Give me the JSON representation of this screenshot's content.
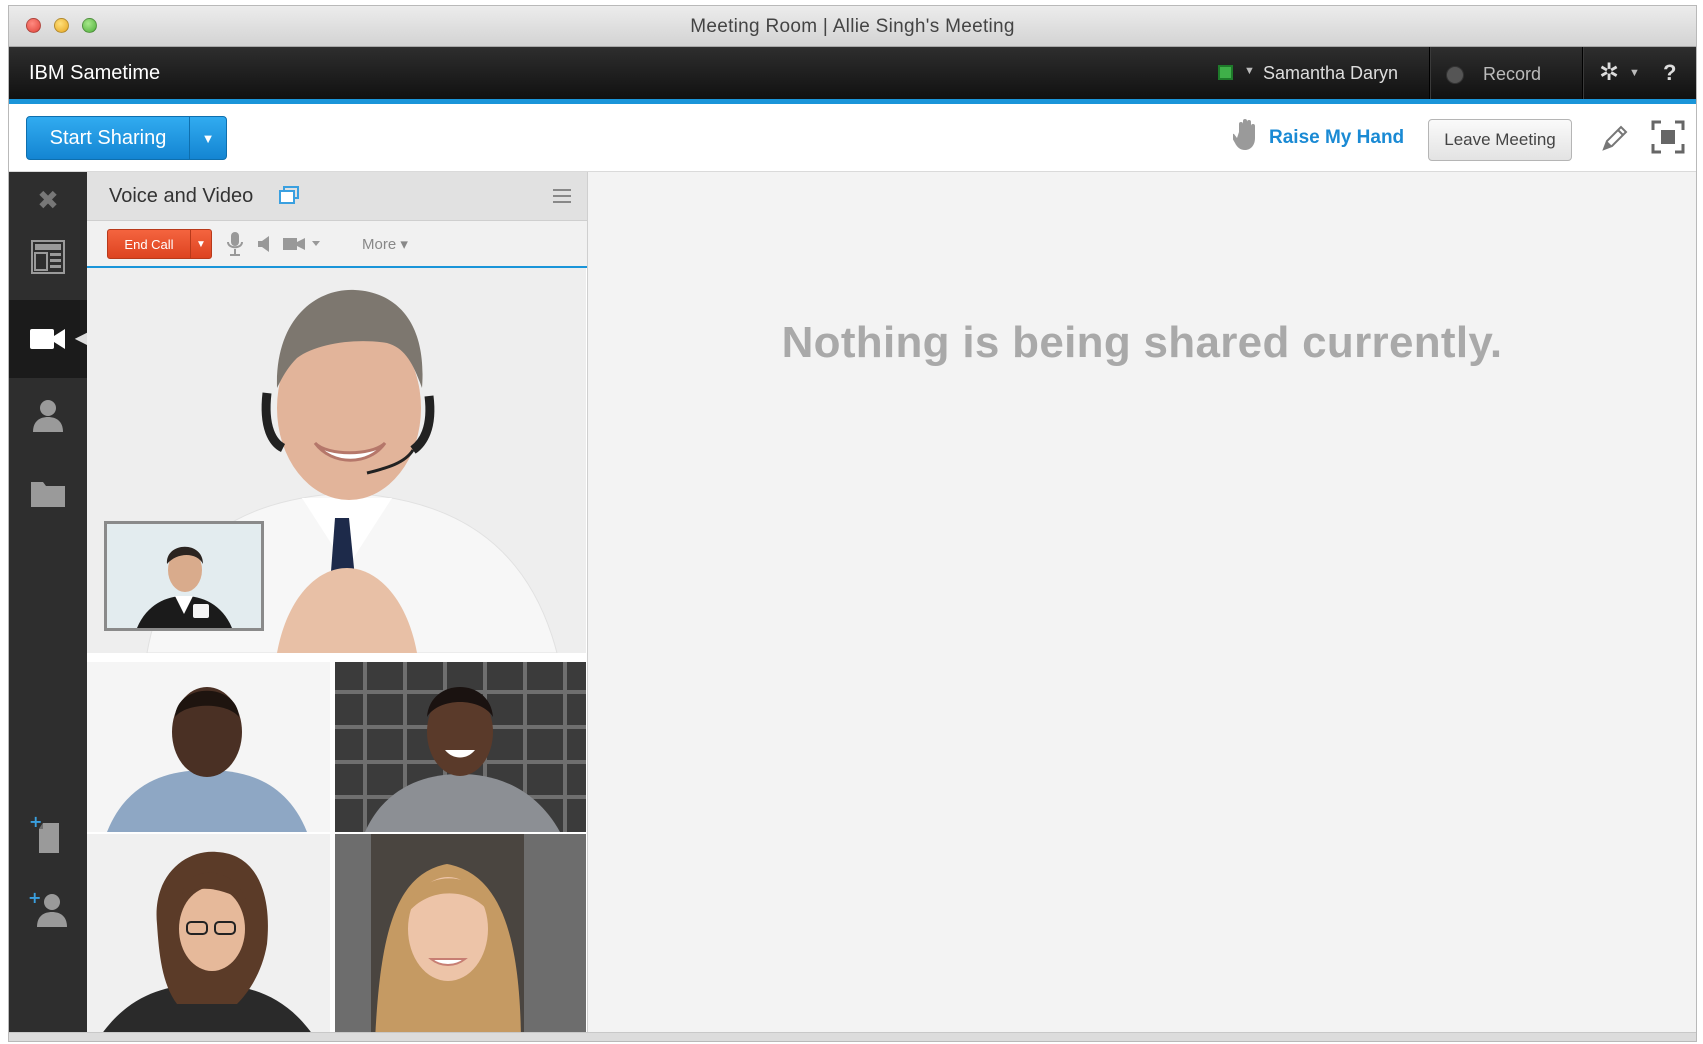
{
  "window": {
    "title": "Meeting Room  |  Allie Singh's Meeting"
  },
  "header": {
    "app_name": "IBM Sametime",
    "user_name": "Samantha Daryn",
    "record_label": "Record",
    "help_label": "?",
    "status_color": "#3fb049"
  },
  "toolbar": {
    "start_sharing_label": "Start Sharing",
    "raise_hand_label": "Raise My Hand",
    "leave_meeting_label": "Leave Meeting"
  },
  "rail": {
    "items": [
      "close-icon",
      "layout-icon",
      "video-camera-icon",
      "person-icon",
      "folder-icon",
      "add-file-icon",
      "add-person-icon"
    ],
    "active": "video-camera-icon"
  },
  "voice_video": {
    "title": "Voice and Video",
    "end_call_label": "End Call",
    "more_label": "More ▾",
    "participants": [
      "main-speaker",
      "self-view",
      "participant-1",
      "participant-2",
      "participant-3",
      "participant-4"
    ]
  },
  "stage": {
    "message": "Nothing is being shared currently."
  },
  "colors": {
    "accent_blue": "#1a95d9",
    "end_call_red": "#e74a27"
  }
}
